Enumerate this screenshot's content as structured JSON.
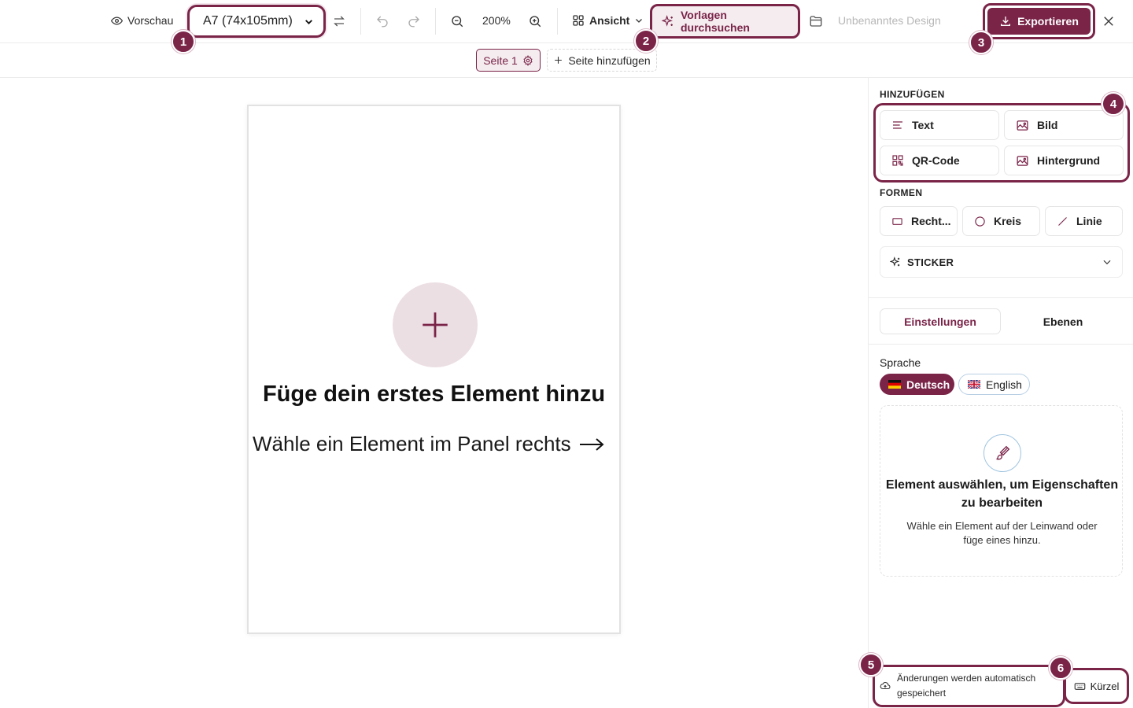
{
  "toolbar": {
    "preview_label": "Vorschau",
    "size_select_value": "A7 (74x105mm)",
    "zoom_value": "200%",
    "view_label": "Ansicht",
    "templates_label": "Vorlagen durchsuchen",
    "design_name": "Unbenanntes Design",
    "export_label": "Exportieren"
  },
  "callouts": [
    "1",
    "2",
    "3",
    "4",
    "5",
    "6"
  ],
  "pagebar": {
    "page_label": "Seite 1",
    "add_page_label": "Seite hinzufügen"
  },
  "canvas": {
    "title": "Füge dein erstes Element hinzu",
    "subtitle": "Wähle ein Element im Panel rechts"
  },
  "panel": {
    "add_section": "HINZUFÜGEN",
    "add_items": [
      {
        "label": "Text",
        "icon": "text-lines-icon"
      },
      {
        "label": "Bild",
        "icon": "image-icon"
      },
      {
        "label": "QR-Code",
        "icon": "qr-code-icon"
      },
      {
        "label": "Hintergrund",
        "icon": "background-image-icon"
      }
    ],
    "shapes_section": "FORMEN",
    "shape_items": [
      {
        "label": "Recht...",
        "icon": "rectangle-icon"
      },
      {
        "label": "Kreis",
        "icon": "circle-icon"
      },
      {
        "label": "Linie",
        "icon": "line-icon"
      }
    ],
    "sticker_label": "STICKER",
    "tabs": [
      "Einstellungen",
      "Ebenen"
    ],
    "language_label": "Sprache",
    "languages": [
      "Deutsch",
      "English"
    ],
    "empty_title": "Element auswählen, um Eigenschaften zu bearbeiten",
    "empty_desc": "Wähle ein Element auf der Leinwand oder füge eines hinzu."
  },
  "footer": {
    "autosave_text": "Änderungen werden automatisch gespeichert",
    "shortcuts_label": "Kürzel"
  },
  "colors": {
    "accent": "#7a2448",
    "accent_light": "#f4ecef",
    "plus_circle": "#ecdfe4"
  }
}
